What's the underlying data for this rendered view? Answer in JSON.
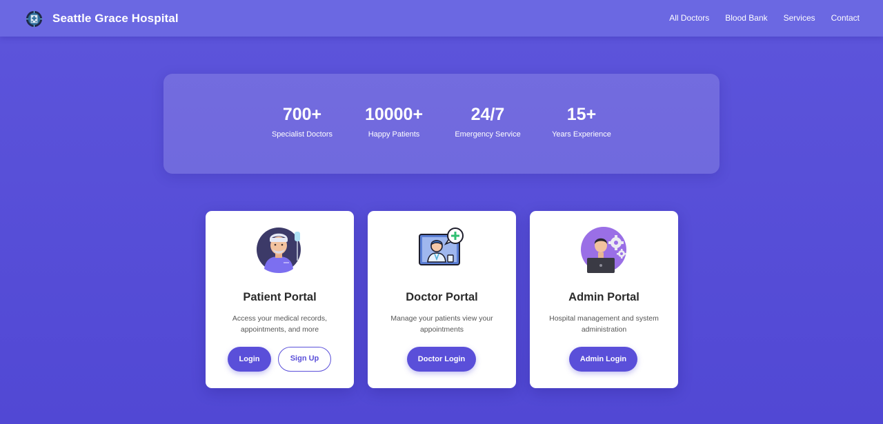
{
  "header": {
    "logo_icon": "hospital-logo-icon",
    "title": "Seattle Grace Hospital",
    "nav": [
      {
        "label": "All Doctors"
      },
      {
        "label": "Blood Bank"
      },
      {
        "label": "Services"
      },
      {
        "label": "Contact"
      }
    ]
  },
  "stats": [
    {
      "value": "700+",
      "label": "Specialist Doctors"
    },
    {
      "value": "10000+",
      "label": "Happy Patients"
    },
    {
      "value": "24/7",
      "label": "Emergency Service"
    },
    {
      "value": "15+",
      "label": "Years Experience"
    }
  ],
  "portals": [
    {
      "icon": "patient-avatar-icon",
      "title": "Patient Portal",
      "description": "Access your medical records, appointments, and more",
      "login_label": "Login",
      "signup_label": "Sign Up"
    },
    {
      "icon": "doctor-telehealth-icon",
      "title": "Doctor Portal",
      "description": "Manage your patients view your appointments",
      "login_label": "Doctor Login"
    },
    {
      "icon": "admin-laptop-gears-icon",
      "title": "Admin Portal",
      "description": "Hospital management and system administration",
      "login_label": "Admin Login"
    }
  ],
  "colors": {
    "background": "#5d55db",
    "navbar": "#6b68e2",
    "accent": "#5a4fd9",
    "card": "#ffffff"
  }
}
